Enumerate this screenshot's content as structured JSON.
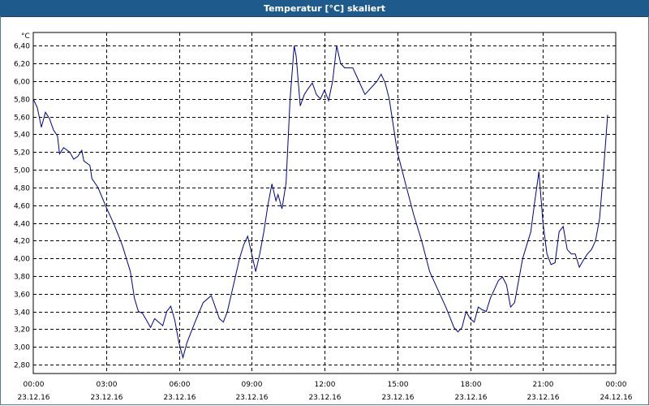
{
  "window": {
    "title": "Temperatur [°C] skaliert"
  },
  "colors": {
    "line": "#00008b",
    "grid": "#000000",
    "title_bg": "#1f5a8c"
  },
  "chart_data": {
    "type": "line",
    "title": "Temperatur [°C] skaliert",
    "unit_label": "°C",
    "ylim": [
      2.7,
      6.55
    ],
    "y_ticks": [
      "2,80",
      "3,00",
      "3,20",
      "3,40",
      "3,60",
      "3,80",
      "4,00",
      "4,20",
      "4,40",
      "4,60",
      "4,80",
      "5,00",
      "5,20",
      "5,40",
      "5,60",
      "5,80",
      "6,00",
      "6,20",
      "6,40"
    ],
    "x_ticks": [
      {
        "time": "00:00",
        "date": "23.12.16"
      },
      {
        "time": "03:00",
        "date": "23.12.16"
      },
      {
        "time": "06:00",
        "date": "23.12.16"
      },
      {
        "time": "09:00",
        "date": "23.12.16"
      },
      {
        "time": "12:00",
        "date": "23.12.16"
      },
      {
        "time": "15:00",
        "date": "23.12.16"
      },
      {
        "time": "18:00",
        "date": "23.12.16"
      },
      {
        "time": "21:00",
        "date": "23.12.16"
      },
      {
        "time": "00:00",
        "date": "24.12.16"
      }
    ],
    "grid": true,
    "series": [
      {
        "points": [
          [
            "23.12.16 00:00",
            5.8
          ],
          [
            "23.12.16 00:10",
            5.7
          ],
          [
            "23.12.16 00:20",
            5.48
          ],
          [
            "23.12.16 00:30",
            5.65
          ],
          [
            "23.12.16 00:40",
            5.58
          ],
          [
            "23.12.16 00:50",
            5.45
          ],
          [
            "23.12.16 01:00",
            5.38
          ],
          [
            "23.12.16 01:05",
            5.18
          ],
          [
            "23.12.16 01:15",
            5.25
          ],
          [
            "23.12.16 01:30",
            5.2
          ],
          [
            "23.12.16 01:40",
            5.12
          ],
          [
            "23.12.16 01:50",
            5.15
          ],
          [
            "23.12.16 02:00",
            5.22
          ],
          [
            "23.12.16 02:05",
            5.1
          ],
          [
            "23.12.16 02:20",
            5.05
          ],
          [
            "23.12.16 02:25",
            4.9
          ],
          [
            "23.12.16 02:40",
            4.8
          ],
          [
            "23.12.16 03:00",
            4.58
          ],
          [
            "23.12.16 03:20",
            4.38
          ],
          [
            "23.12.16 03:40",
            4.15
          ],
          [
            "23.12.16 04:00",
            3.85
          ],
          [
            "23.12.16 04:10",
            3.55
          ],
          [
            "23.12.16 04:20",
            3.4
          ],
          [
            "23.12.16 04:30",
            3.38
          ],
          [
            "23.12.16 04:40",
            3.3
          ],
          [
            "23.12.16 04:50",
            3.22
          ],
          [
            "23.12.16 05:00",
            3.32
          ],
          [
            "23.12.16 05:10",
            3.28
          ],
          [
            "23.12.16 05:20",
            3.24
          ],
          [
            "23.12.16 05:30",
            3.4
          ],
          [
            "23.12.16 05:40",
            3.46
          ],
          [
            "23.12.16 05:50",
            3.3
          ],
          [
            "23.12.16 06:00",
            3.05
          ],
          [
            "23.12.16 06:10",
            2.88
          ],
          [
            "23.12.16 06:20",
            3.05
          ],
          [
            "23.12.16 06:40",
            3.28
          ],
          [
            "23.12.16 07:00",
            3.5
          ],
          [
            "23.12.16 07:20",
            3.58
          ],
          [
            "23.12.16 07:40",
            3.32
          ],
          [
            "23.12.16 07:50",
            3.28
          ],
          [
            "23.12.16 08:00",
            3.4
          ],
          [
            "23.12.16 08:10",
            3.6
          ],
          [
            "23.12.16 08:20",
            3.8
          ],
          [
            "23.12.16 08:30",
            4.0
          ],
          [
            "23.12.16 08:40",
            4.15
          ],
          [
            "23.12.16 08:50",
            4.25
          ],
          [
            "23.12.16 09:00",
            4.05
          ],
          [
            "23.12.16 09:10",
            3.85
          ],
          [
            "23.12.16 09:20",
            4.05
          ],
          [
            "23.12.16 09:30",
            4.3
          ],
          [
            "23.12.16 09:40",
            4.6
          ],
          [
            "23.12.16 09:50",
            4.84
          ],
          [
            "23.12.16 10:00",
            4.65
          ],
          [
            "23.12.16 10:05",
            4.72
          ],
          [
            "23.12.16 10:15",
            4.56
          ],
          [
            "23.12.16 10:25",
            4.85
          ],
          [
            "23.12.16 10:35",
            5.8
          ],
          [
            "23.12.16 10:45",
            6.4
          ],
          [
            "23.12.16 10:50",
            6.28
          ],
          [
            "23.12.16 11:00",
            5.72
          ],
          [
            "23.12.16 11:10",
            5.85
          ],
          [
            "23.12.16 11:20",
            5.92
          ],
          [
            "23.12.16 11:30",
            5.98
          ],
          [
            "23.12.16 11:40",
            5.85
          ],
          [
            "23.12.16 11:50",
            5.8
          ],
          [
            "23.12.16 12:00",
            5.9
          ],
          [
            "23.12.16 12:10",
            5.78
          ],
          [
            "23.12.16 12:20",
            6.0
          ],
          [
            "23.12.16 12:30",
            6.4
          ],
          [
            "23.12.16 12:40",
            6.2
          ],
          [
            "23.12.16 12:50",
            6.15
          ],
          [
            "23.12.16 13:10",
            6.15
          ],
          [
            "23.12.16 13:20",
            6.05
          ],
          [
            "23.12.16 13:30",
            5.95
          ],
          [
            "23.12.16 13:40",
            5.85
          ],
          [
            "23.12.16 13:50",
            5.9
          ],
          [
            "23.12.16 14:00",
            5.95
          ],
          [
            "23.12.16 14:10",
            6.0
          ],
          [
            "23.12.16 14:20",
            6.08
          ],
          [
            "23.12.16 14:30",
            5.98
          ],
          [
            "23.12.16 14:40",
            5.8
          ],
          [
            "23.12.16 14:50",
            5.5
          ],
          [
            "23.12.16 15:00",
            5.2
          ],
          [
            "23.12.16 15:20",
            4.85
          ],
          [
            "23.12.16 15:40",
            4.5
          ],
          [
            "23.12.16 16:00",
            4.2
          ],
          [
            "23.12.16 16:20",
            3.85
          ],
          [
            "23.12.16 16:40",
            3.65
          ],
          [
            "23.12.16 17:00",
            3.45
          ],
          [
            "23.12.16 17:20",
            3.22
          ],
          [
            "23.12.16 17:30",
            3.17
          ],
          [
            "23.12.16 17:40",
            3.22
          ],
          [
            "23.12.16 17:50",
            3.4
          ],
          [
            "23.12.16 18:00",
            3.32
          ],
          [
            "23.12.16 18:10",
            3.28
          ],
          [
            "23.12.16 18:20",
            3.45
          ],
          [
            "23.12.16 18:30",
            3.42
          ],
          [
            "23.12.16 18:40",
            3.4
          ],
          [
            "23.12.16 18:50",
            3.55
          ],
          [
            "23.12.16 19:00",
            3.65
          ],
          [
            "23.12.16 19:10",
            3.75
          ],
          [
            "23.12.16 19:20",
            3.79
          ],
          [
            "23.12.16 19:30",
            3.7
          ],
          [
            "23.12.16 19:40",
            3.45
          ],
          [
            "23.12.16 19:50",
            3.5
          ],
          [
            "23.12.16 20:00",
            3.75
          ],
          [
            "23.12.16 20:10",
            4.0
          ],
          [
            "23.12.16 20:20",
            4.15
          ],
          [
            "23.12.16 20:30",
            4.3
          ],
          [
            "23.12.16 20:40",
            4.65
          ],
          [
            "23.12.16 20:50",
            4.98
          ],
          [
            "23.12.16 21:00",
            4.4
          ],
          [
            "23.12.16 21:10",
            4.05
          ],
          [
            "23.12.16 21:20",
            3.93
          ],
          [
            "23.12.16 21:30",
            3.95
          ],
          [
            "23.12.16 21:40",
            4.3
          ],
          [
            "23.12.16 21:50",
            4.36
          ],
          [
            "23.12.16 22:00",
            4.1
          ],
          [
            "23.12.16 22:10",
            4.05
          ],
          [
            "23.12.16 22:20",
            4.05
          ],
          [
            "23.12.16 22:30",
            3.9
          ],
          [
            "23.12.16 22:40",
            3.98
          ],
          [
            "23.12.16 22:50",
            4.05
          ],
          [
            "23.12.16 23:00",
            4.1
          ],
          [
            "23.12.16 23:10",
            4.2
          ],
          [
            "23.12.16 23:20",
            4.45
          ],
          [
            "23.12.16 23:30",
            5.0
          ],
          [
            "23.12.16 23:40",
            5.62
          ]
        ]
      }
    ]
  }
}
